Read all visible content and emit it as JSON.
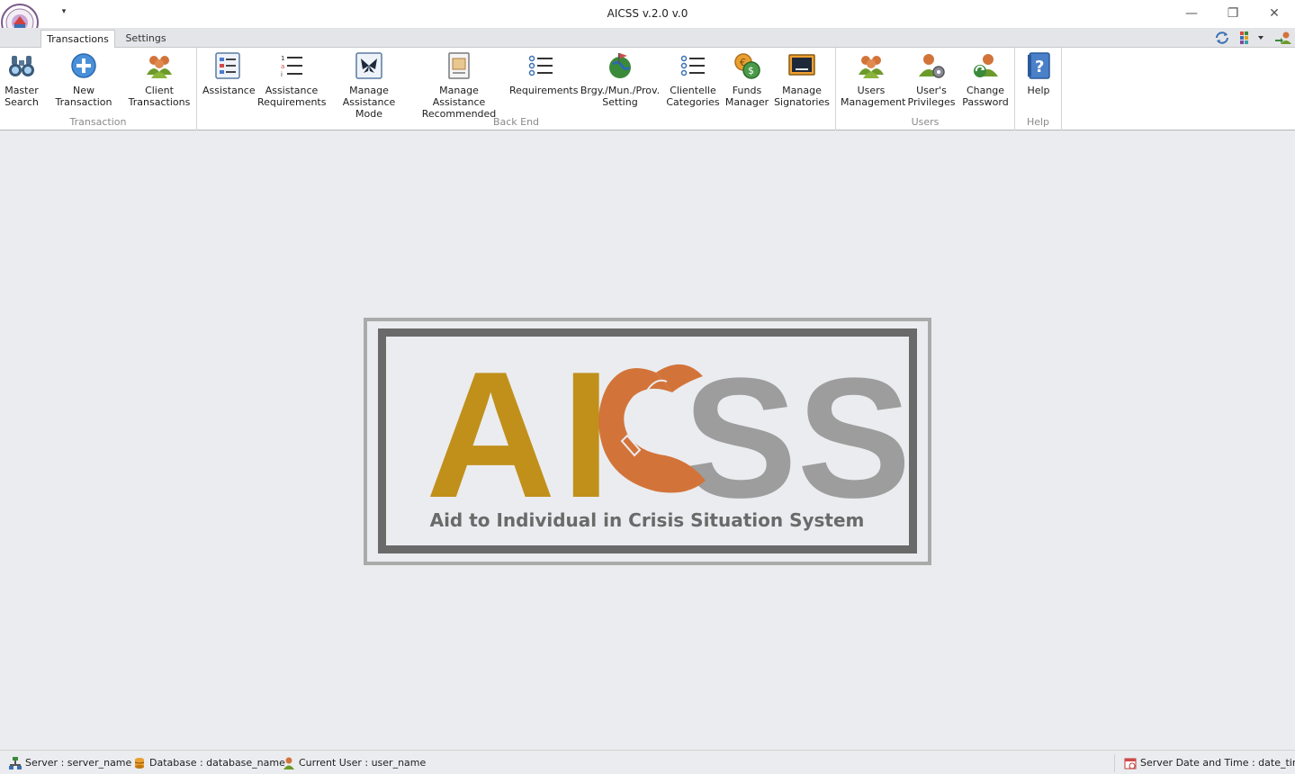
{
  "window": {
    "title": "AICSS v.2.0 v.0",
    "logo_text": "PROVINCE OF SORSOGON · SOCIAL WELFARE",
    "minimize_glyph": "—",
    "restore_glyph": "❐",
    "close_glyph": "✕",
    "qat_glyph": "▾"
  },
  "tabs": [
    {
      "label": "Transactions",
      "active": true
    },
    {
      "label": "Settings",
      "active": false
    }
  ],
  "ribbon": {
    "groups": [
      {
        "caption": "Transaction",
        "buttons": [
          {
            "label": "Master\nSearch",
            "icon": "binoculars-icon"
          },
          {
            "label": "New Transaction",
            "icon": "add-circle-icon"
          },
          {
            "label": "Client\nTransactions",
            "icon": "users-group-icon"
          }
        ]
      },
      {
        "caption": "Back End",
        "buttons": [
          {
            "label": "Assistance",
            "icon": "list-form-icon"
          },
          {
            "label": "Assistance\nRequirements",
            "icon": "numbered-list-icon"
          },
          {
            "label": "Manage\nAssistance Mode",
            "icon": "butterfly-icon"
          },
          {
            "label": "Manage Assistance\nRecommended",
            "icon": "document-icon"
          },
          {
            "label": "Requirements",
            "icon": "bullet-list-icon"
          },
          {
            "label": "Brgy./Mun./Prov.\nSetting",
            "icon": "globe-flag-icon"
          },
          {
            "label": "Clientelle\nCategories",
            "icon": "bullet-list-icon"
          },
          {
            "label": "Funds\nManager",
            "icon": "coins-icon"
          },
          {
            "label": "Manage\nSignatories",
            "icon": "monitor-icon"
          }
        ]
      },
      {
        "caption": "Users",
        "buttons": [
          {
            "label": "Users\nManagement",
            "icon": "users-group-icon"
          },
          {
            "label": "User's\nPrivileges",
            "icon": "user-gear-icon"
          },
          {
            "label": "Change\nPassword",
            "icon": "user-refresh-icon"
          }
        ]
      },
      {
        "caption": "Help",
        "buttons": [
          {
            "label": "Help",
            "icon": "help-book-icon"
          }
        ]
      }
    ]
  },
  "logo": {
    "ai": "AI",
    "ss": "SS",
    "tagline": "Aid to Individual in Crisis Situation System",
    "colors": {
      "gold": "#c0901a",
      "orange": "#d2743a",
      "light_gray": "#9d9d9d",
      "dark_gray": "#6a6a6a"
    }
  },
  "statusbar": {
    "server": "Server : server_name",
    "database": "Database : database_name",
    "user": "Current User : user_name",
    "datetime": "Server Date and Time : date_time"
  }
}
